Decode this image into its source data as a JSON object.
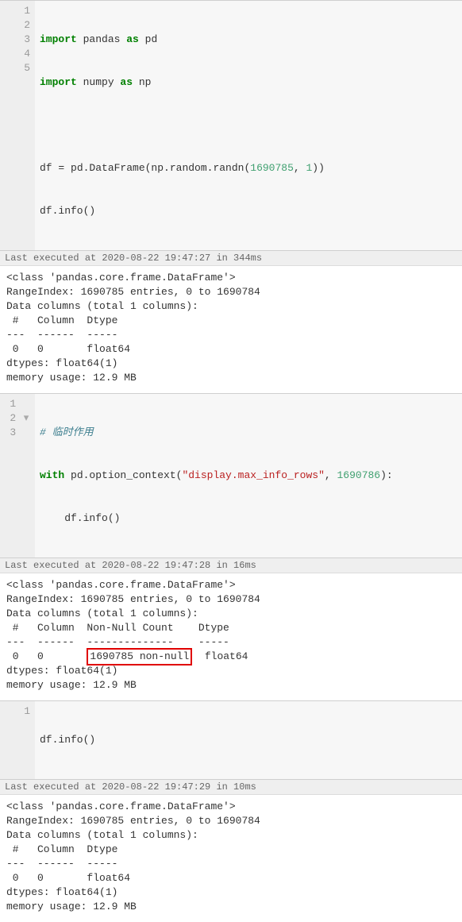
{
  "cells": [
    {
      "lines": [
        "1",
        "2",
        "3",
        "4",
        "5"
      ],
      "folds": [
        "",
        "",
        "",
        "",
        ""
      ],
      "code_html": [
        "<span class='kw'>import</span> pandas <span class='kw'>as</span> pd",
        "<span class='kw'>import</span> numpy <span class='kw'>as</span> np",
        "",
        "df <span class='op'>=</span> pd.DataFrame(np.random.randn(<span class='num'>1690785</span>, <span class='num'>1</span>))",
        "df.info()"
      ],
      "exec": "Last executed at 2020-08-22 19:47:27 in 344ms",
      "output": "<class 'pandas.core.frame.DataFrame'>\nRangeIndex: 1690785 entries, 0 to 1690784\nData columns (total 1 columns):\n #   Column  Dtype  \n---  ------  -----  \n 0   0       float64\ndtypes: float64(1)\nmemory usage: 12.9 MB"
    },
    {
      "lines": [
        "1",
        "2",
        "3"
      ],
      "folds": [
        "",
        "▾",
        ""
      ],
      "code_html": [
        "<span class='comment'># 临时作用</span>",
        "<span class='kw'>with</span> pd.option_context(<span class='str'>\"display.max_info_rows\"</span>, <span class='num'>1690786</span>):",
        "    df.info()"
      ],
      "exec": "Last executed at 2020-08-22 19:47:28 in 16ms",
      "output_segments": [
        {
          "type": "text",
          "value": "<class 'pandas.core.frame.DataFrame'>\nRangeIndex: 1690785 entries, 0 to 1690784\nData columns (total 1 columns):\n #   Column  Non-Null Count    Dtype  \n---  ------  --------------    -----  \n 0   0       "
        },
        {
          "type": "highlight",
          "value": "1690785 non-null"
        },
        {
          "type": "text",
          "value": "  float64\ndtypes: float64(1)\nmemory usage: 12.9 MB"
        }
      ]
    },
    {
      "lines": [
        "1"
      ],
      "folds": [
        ""
      ],
      "code_html": [
        "df.info()"
      ],
      "exec": "Last executed at 2020-08-22 19:47:29 in 10ms",
      "output": "<class 'pandas.core.frame.DataFrame'>\nRangeIndex: 1690785 entries, 0 to 1690784\nData columns (total 1 columns):\n #   Column  Dtype  \n---  ------  -----  \n 0   0       float64\ndtypes: float64(1)\nmemory usage: 12.9 MB"
    }
  ]
}
